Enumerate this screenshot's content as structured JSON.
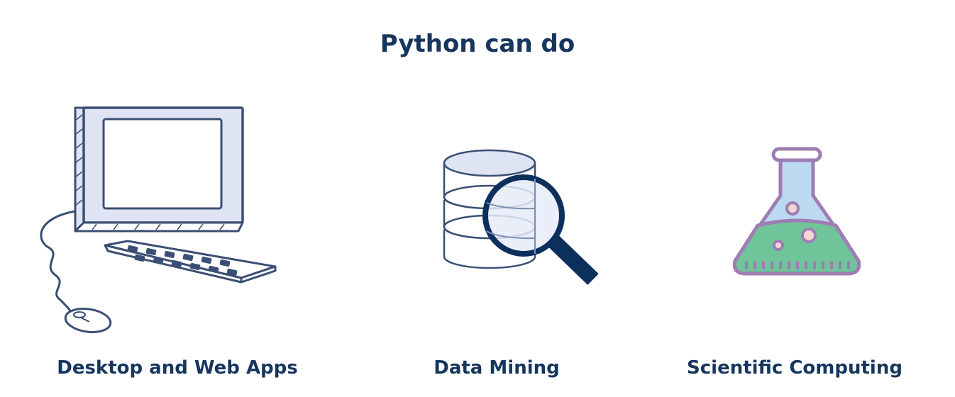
{
  "title": "Python can do",
  "colors": {
    "text": "#16365e",
    "outline": "#3a4f73",
    "screen_fill": "#dfe4f5",
    "magnifier": "#0d2f5c",
    "flask_outline": "#9e7db3",
    "flask_glass": "#bcd9f2",
    "flask_liquid": "#6fc49a"
  },
  "cards": [
    {
      "label": "Desktop and Web Apps",
      "icon": "computer-icon"
    },
    {
      "label": "Data Mining",
      "icon": "database-magnifier-icon"
    },
    {
      "label": "Scientific Computing",
      "icon": "flask-icon"
    }
  ]
}
